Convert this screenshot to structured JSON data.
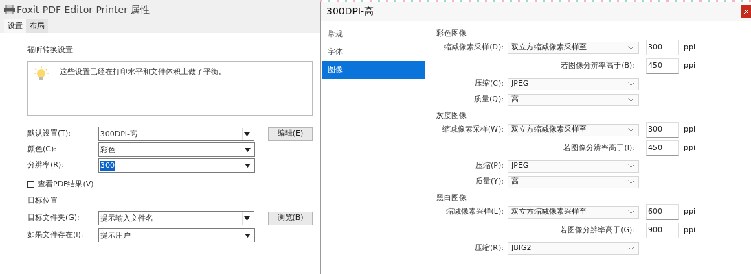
{
  "left_window": {
    "title": "Foxit PDF Editor Printer 属性",
    "tabs": [
      {
        "label": "设置",
        "selected": true
      },
      {
        "label": "布局",
        "selected": false
      }
    ],
    "section_title": "福昕转换设置",
    "info_text": "这些设置已经在打印水平和文件体积上做了平衡。",
    "fields": [
      {
        "label": "默认设置(T):",
        "value": "300DPI-高",
        "highlighted": false,
        "button": "编辑(E)"
      },
      {
        "label": "颜色(C):",
        "value": "彩色",
        "highlighted": false
      },
      {
        "label": "分辨率(R):",
        "value": "300",
        "highlighted": true
      }
    ],
    "view_result": {
      "label": "查看PDF结果(V)",
      "checked": false
    },
    "target_title": "目标位置",
    "target_fields": [
      {
        "label": "目标文件夹(G):",
        "value": "提示输入文件名",
        "highlighted": false,
        "button": "浏览(B)"
      },
      {
        "label": "如果文件存在(I):",
        "value": "提示用户",
        "highlighted": false
      }
    ]
  },
  "right_window": {
    "title": "300DPI-高",
    "sidebar": [
      {
        "label": "常规",
        "selected": false
      },
      {
        "label": "字体",
        "selected": false
      },
      {
        "label": "图像",
        "selected": true
      }
    ],
    "groups": [
      {
        "title": "彩色图像",
        "rows": [
          {
            "kind": "downsample",
            "label": "缩减像素采样(D):",
            "method": "双立方缩减像素采样至",
            "value": "300",
            "unit": "ppi"
          },
          {
            "kind": "threshold",
            "label": "若图像分辨率高于(B):",
            "value": "450",
            "unit": "ppi"
          },
          {
            "kind": "select",
            "label": "压缩(C):",
            "value": "JPEG"
          },
          {
            "kind": "select",
            "label": "质量(Q):",
            "value": "高"
          }
        ]
      },
      {
        "title": "灰度图像",
        "rows": [
          {
            "kind": "downsample",
            "label": "缩减像素采样(W):",
            "method": "双立方缩减像素采样至",
            "value": "300",
            "unit": "ppi"
          },
          {
            "kind": "threshold",
            "label": "若图像分辨率高于(I):",
            "value": "450",
            "unit": "ppi"
          },
          {
            "kind": "select",
            "label": "压缩(P):",
            "value": "JPEG"
          },
          {
            "kind": "select",
            "label": "质量(Y):",
            "value": "高"
          }
        ]
      },
      {
        "title": "黑白图像",
        "rows": [
          {
            "kind": "downsample",
            "label": "缩减像素采样(L):",
            "method": "双立方缩减像素采样至",
            "value": "600",
            "unit": "ppi"
          },
          {
            "kind": "threshold",
            "label": "若图像分辨率高于(G):",
            "value": "900",
            "unit": "ppi"
          },
          {
            "kind": "select",
            "label": "压缩(R):",
            "value": "JBIG2"
          }
        ]
      }
    ]
  }
}
